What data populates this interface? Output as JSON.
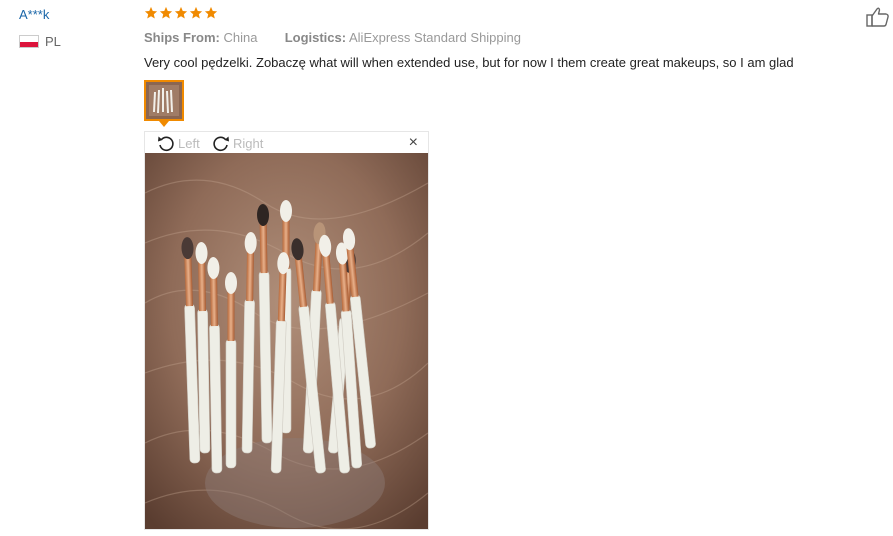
{
  "reviewer": {
    "name": "A***k",
    "country_code": "PL",
    "flag": "poland-flag"
  },
  "rating": {
    "stars": 5,
    "max": 5,
    "color": "#f08a00"
  },
  "meta": {
    "ships_from_label": "Ships From:",
    "ships_from_value": "China",
    "logistics_label": "Logistics:",
    "logistics_value": "AliExpress Standard Shipping"
  },
  "review": {
    "text": "Very cool pędzelki. Zobaczę what will when extended use, but for now I them create great makeups, so I am glad"
  },
  "viewer": {
    "rotate_left_label": "Left",
    "rotate_right_label": "Right",
    "close_label": "×"
  },
  "colors": {
    "accent": "#f08a00",
    "link": "#1a66a8"
  }
}
